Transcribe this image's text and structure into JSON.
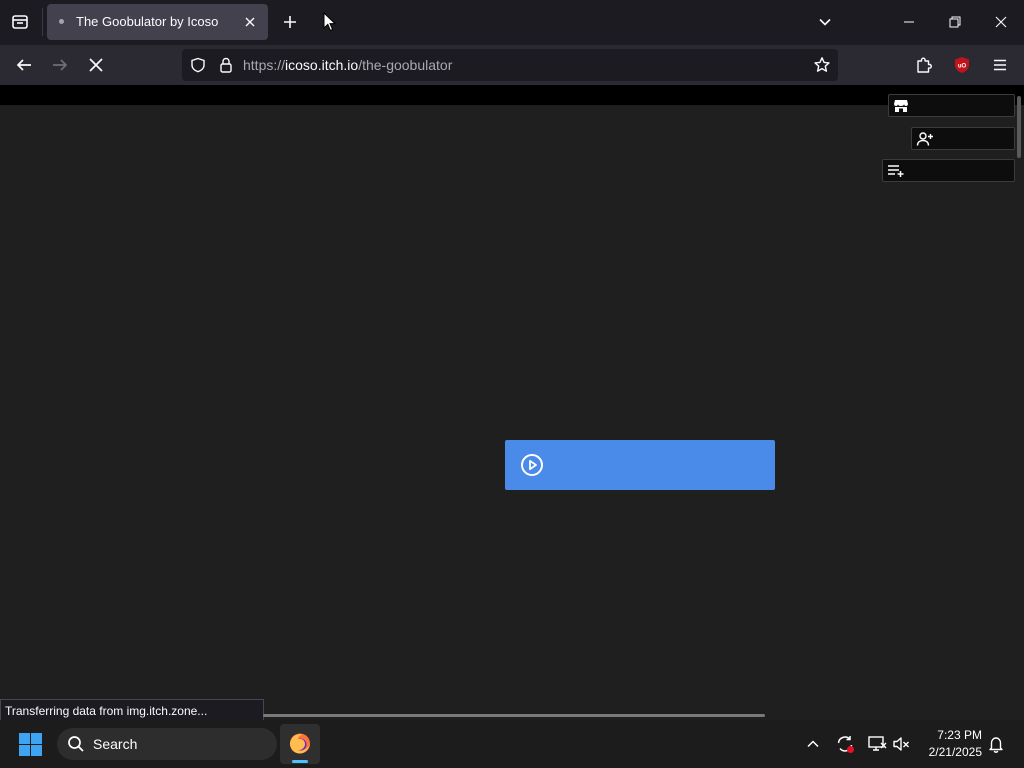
{
  "browser": {
    "tab": {
      "title": "The Goobulator by Icoso"
    },
    "url": {
      "prefix": "https://",
      "host": "icoso.itch.io",
      "path": "/the-goobulator"
    },
    "status_text": "Transferring data from img.itch.zone..."
  },
  "page": {
    "side_buttons": [
      {
        "icon": "store-icon",
        "label": ""
      },
      {
        "icon": "add-user-icon",
        "label": ""
      },
      {
        "icon": "add-to-collection-icon",
        "label": ""
      }
    ],
    "play_button": {
      "icon": "play-circle-icon",
      "label": ""
    }
  },
  "taskbar": {
    "search_label": "Search",
    "clock_time": "7:23 PM",
    "clock_date": "2/21/2025"
  },
  "colors": {
    "accent_button": "#4a8ae8",
    "page_background": "#1f1f1f",
    "ublock_badge": "#c0141c",
    "taskbar_indicator": "#4cc2ff"
  }
}
